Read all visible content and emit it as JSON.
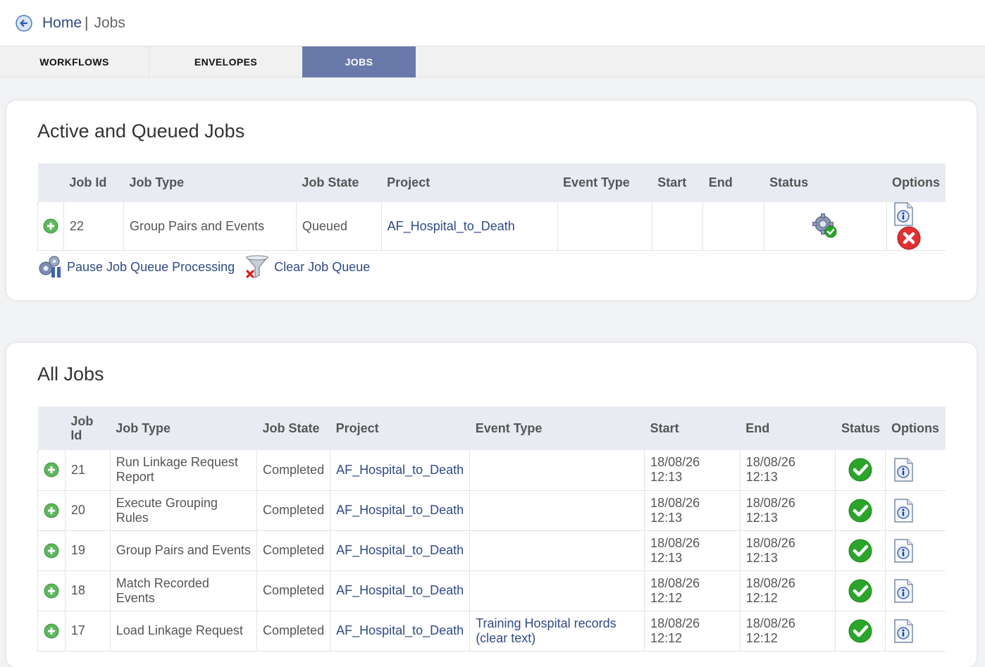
{
  "breadcrumb": {
    "home": "Home",
    "separator": "|",
    "current": "Jobs"
  },
  "tabs": [
    {
      "label": "WORKFLOWS"
    },
    {
      "label": "ENVELOPES"
    },
    {
      "label": "JOBS"
    }
  ],
  "active_jobs": {
    "title": "Active and Queued Jobs",
    "columns": [
      "Job Id",
      "Job Type",
      "Job State",
      "Project",
      "Event Type",
      "Start",
      "End",
      "Status",
      "Options"
    ],
    "rows": [
      {
        "id": "22",
        "type": "Group Pairs and Events",
        "state": "Queued",
        "project": "AF_Hospital_to_Death",
        "event_type": "",
        "start": "",
        "end": "",
        "status_icon": "gear-check-icon",
        "options": [
          "info-icon",
          "delete-icon"
        ]
      }
    ],
    "actions": {
      "pause": "Pause Job Queue Processing",
      "clear": "Clear Job Queue"
    }
  },
  "all_jobs": {
    "title": "All Jobs",
    "columns": [
      "Job Id",
      "Job Type",
      "Job State",
      "Project",
      "Event Type",
      "Start",
      "End",
      "Status",
      "Options"
    ],
    "rows": [
      {
        "id": "21",
        "type": "Run Linkage Request Report",
        "state": "Completed",
        "project": "AF_Hospital_to_Death",
        "event_type": "",
        "start": "18/08/26 12:13",
        "end": "18/08/26 12:13"
      },
      {
        "id": "20",
        "type": "Execute Grouping Rules",
        "state": "Completed",
        "project": "AF_Hospital_to_Death",
        "event_type": "",
        "start": "18/08/26 12:13",
        "end": "18/08/26 12:13"
      },
      {
        "id": "19",
        "type": "Group Pairs and Events",
        "state": "Completed",
        "project": "AF_Hospital_to_Death",
        "event_type": "",
        "start": "18/08/26 12:13",
        "end": "18/08/26 12:13"
      },
      {
        "id": "18",
        "type": "Match Recorded Events",
        "state": "Completed",
        "project": "AF_Hospital_to_Death",
        "event_type": "",
        "start": "18/08/26 12:12",
        "end": "18/08/26 12:12"
      },
      {
        "id": "17",
        "type": "Load Linkage Request",
        "state": "Completed",
        "project": "AF_Hospital_to_Death",
        "event_type": "Training Hospital records (clear text)",
        "start": "18/08/26 12:12",
        "end": "18/08/26 12:12"
      }
    ]
  },
  "colors": {
    "link": "#2f4a86",
    "tab_active": "#6979a9",
    "header_bg": "#e8ecf2",
    "success": "#2aa52a",
    "danger": "#e03030"
  }
}
